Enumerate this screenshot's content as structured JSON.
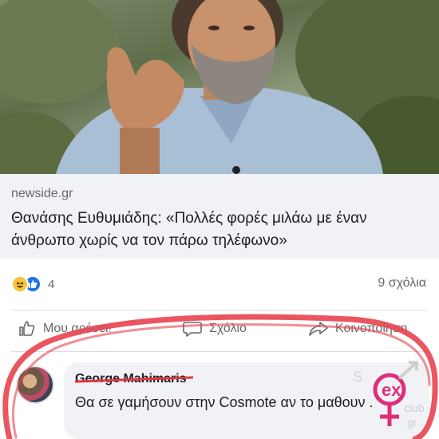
{
  "post": {
    "source": "newside.gr",
    "headline": "Θανάσης Ευθυμιάδης: «Πολλές φορές μιλάω με έναν άνθρωπο χωρίς να τον πάρω τηλέφωνο»"
  },
  "stats": {
    "reaction_count": "4",
    "comments_count": "9 σχόλια"
  },
  "actions": {
    "like_label": "Μου αρέσει!",
    "comment_label": "Σχόλιο",
    "share_label": "Κοινοποίηση"
  },
  "comment": {
    "author": "George Mahimaris",
    "text": "Θα σε γαμήσουν στην Cosmote αν το μαθουν ."
  },
  "watermark": {
    "text": "sex club.gr"
  },
  "colors": {
    "annotation_red": "#e8434f",
    "facebook_blue": "#1b74e4",
    "muted_text": "#65676b"
  }
}
